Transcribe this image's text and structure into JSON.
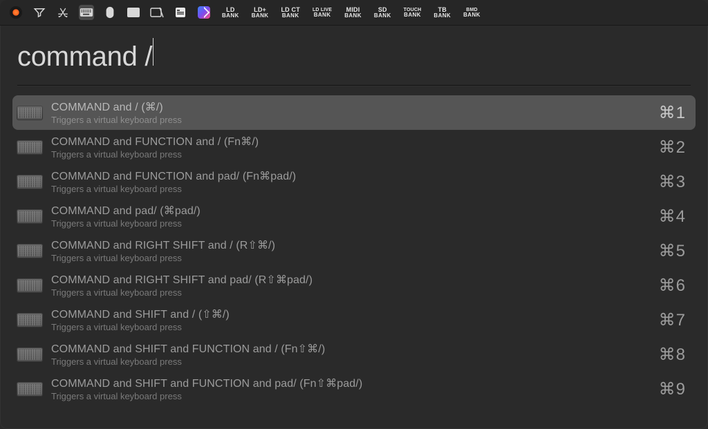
{
  "toolbar": {
    "banks": [
      {
        "top": "LD",
        "bottom": "BANK",
        "small": false
      },
      {
        "top": "LD+",
        "bottom": "BANK",
        "small": false
      },
      {
        "top": "LD CT",
        "bottom": "BANK",
        "small": false
      },
      {
        "top": "LD LIVE",
        "bottom": "BANK",
        "small": true
      },
      {
        "top": "MIDI",
        "bottom": "BANK",
        "small": false
      },
      {
        "top": "SD",
        "bottom": "BANK",
        "small": false
      },
      {
        "top": "TOUCH",
        "bottom": "BANK",
        "small": true
      },
      {
        "top": "TB",
        "bottom": "BANK",
        "small": false
      },
      {
        "top": "BMD",
        "bottom": "BANK",
        "small": true
      }
    ]
  },
  "search": {
    "query": "command /"
  },
  "results": [
    {
      "title": "COMMAND and / (⌘/)",
      "subtitle": "Triggers a virtual keyboard press",
      "shortcut": "⌘1"
    },
    {
      "title": "COMMAND and FUNCTION and / (Fn⌘/)",
      "subtitle": "Triggers a virtual keyboard press",
      "shortcut": "⌘2"
    },
    {
      "title": "COMMAND and FUNCTION and pad/ (Fn⌘pad/)",
      "subtitle": "Triggers a virtual keyboard press",
      "shortcut": "⌘3"
    },
    {
      "title": "COMMAND and pad/ (⌘pad/)",
      "subtitle": "Triggers a virtual keyboard press",
      "shortcut": "⌘4"
    },
    {
      "title": "COMMAND and RIGHT SHIFT and / (R⇧⌘/)",
      "subtitle": "Triggers a virtual keyboard press",
      "shortcut": "⌘5"
    },
    {
      "title": "COMMAND and RIGHT SHIFT and pad/ (R⇧⌘pad/)",
      "subtitle": "Triggers a virtual keyboard press",
      "shortcut": "⌘6"
    },
    {
      "title": "COMMAND and SHIFT and / (⇧⌘/)",
      "subtitle": "Triggers a virtual keyboard press",
      "shortcut": "⌘7"
    },
    {
      "title": "COMMAND and SHIFT and FUNCTION and / (Fn⇧⌘/)",
      "subtitle": "Triggers a virtual keyboard press",
      "shortcut": "⌘8"
    },
    {
      "title": "COMMAND and SHIFT and FUNCTION and pad/ (Fn⇧⌘pad/)",
      "subtitle": "Triggers a virtual keyboard press",
      "shortcut": "⌘9"
    }
  ],
  "selected_index": 0
}
